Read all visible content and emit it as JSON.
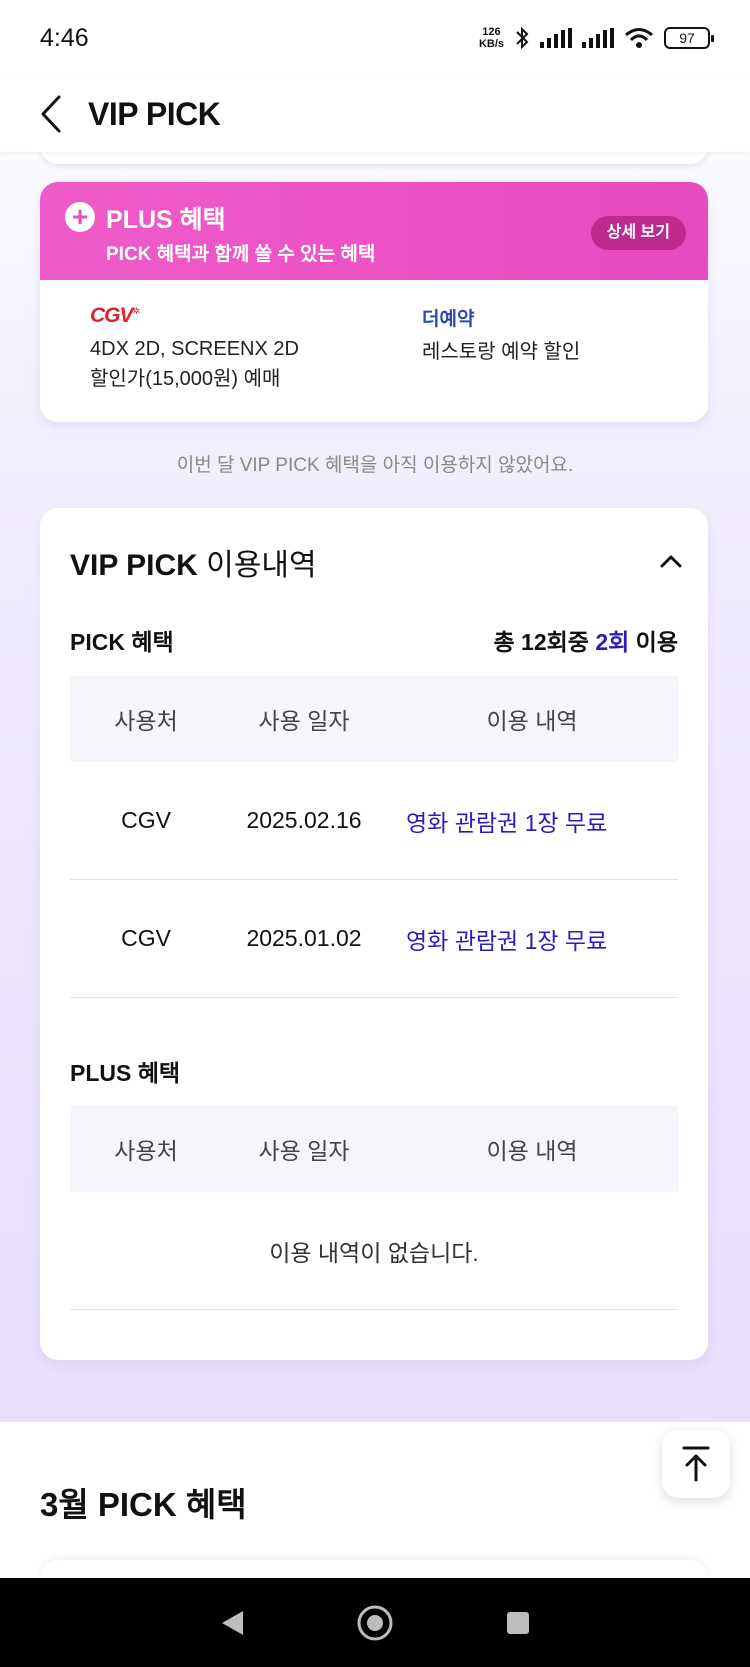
{
  "status_bar": {
    "time": "4:46",
    "net_speed_value": "126",
    "net_speed_unit": "KB/s",
    "battery": "97"
  },
  "header": {
    "title": "VIP PICK"
  },
  "plus_card": {
    "title": "PLUS 혜택",
    "subtitle": "PICK 혜택과 함께 쓸 수 있는 혜택",
    "detail_button": "상세 보기",
    "partners": [
      {
        "logo_text": "CGV",
        "line1": "4DX 2D, SCREENX 2D",
        "line2": "할인가(15,000원) 예매"
      },
      {
        "logo_text": "더예약",
        "line1": "레스토랑 예약 할인"
      }
    ]
  },
  "notice": "이번 달 VIP PICK 혜택을 아직 이용하지 않았어요.",
  "history": {
    "title_bold": "VIP PICK",
    "title_rest": " 이용내역",
    "pick_section": {
      "label": "PICK 혜택",
      "count_prefix": "총 12회중 ",
      "count_used": "2회",
      "count_suffix": " 이용",
      "columns": [
        "사용처",
        "사용 일자",
        "이용 내역"
      ],
      "rows": [
        {
          "place": "CGV",
          "date": "2025.02.16",
          "detail": "영화 관람권 1장 무료"
        },
        {
          "place": "CGV",
          "date": "2025.01.02",
          "detail": "영화 관람권 1장 무료"
        }
      ]
    },
    "plus_section": {
      "label": "PLUS 혜택",
      "columns": [
        "사용처",
        "사용 일자",
        "이용 내역"
      ],
      "empty_text": "이용 내역이 없습니다."
    }
  },
  "march_section": {
    "title": "3월 PICK 혜택"
  },
  "colors": {
    "accent_pink": "#e84ac0",
    "link_blue": "#2b1cbc",
    "cgv_red": "#e0202b"
  }
}
